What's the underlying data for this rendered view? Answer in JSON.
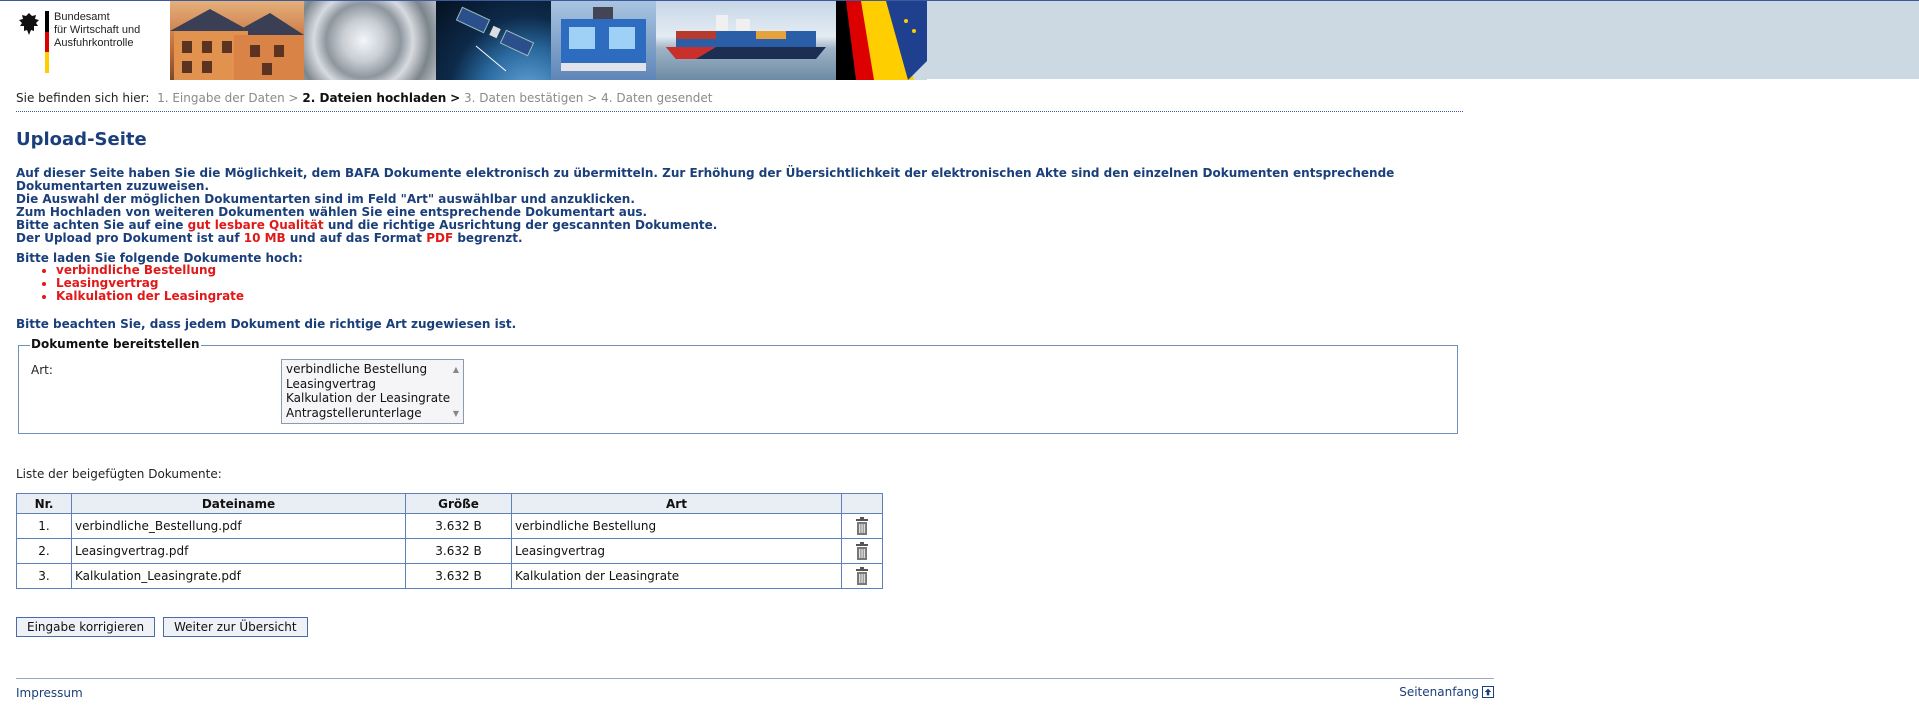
{
  "header": {
    "logo_lines": [
      "Bundesamt",
      "für Wirtschaft und",
      "Ausfuhrkontrolle"
    ],
    "flag_colors": [
      "#000000",
      "#dd0000",
      "#ffce00"
    ],
    "banner_images": [
      "houses-solar",
      "steel-coil",
      "satellite-earth",
      "industrial-machine",
      "container-ship",
      "flags-germany-eu"
    ]
  },
  "breadcrumb": {
    "prefix": "Sie befinden sich hier:",
    "step1": "1. Eingabe der Daten",
    "step2": "2. Dateien hochladen",
    "step3": "3. Daten bestätigen",
    "step4": "4. Daten gesendet",
    "sep": ">"
  },
  "page": {
    "title": "Upload-Seite",
    "intro_1": "Auf dieser Seite haben Sie die Möglichkeit, dem BAFA Dokumente elektronisch zu übermitteln. Zur Erhöhung der Übersichtlichkeit der elektronischen Akte sind den einzelnen Dokumenten entsprechende Dokumentarten zuzuweisen.",
    "intro_2": "Die Auswahl der möglichen Dokumentarten sind im Feld \"Art\" auswählbar und anzuklicken.",
    "intro_3": "Zum Hochladen von weiteren Dokumenten wählen Sie eine entsprechende Dokumentart aus.",
    "intro_4a": "Bitte achten Sie auf eine",
    "intro_4b": "gut lesbare Qualität",
    "intro_4c": "und die richtige Ausrichtung der gescannten Dokumente.",
    "intro_5a": "Der Upload pro Dokument ist auf",
    "intro_5b": "10 MB",
    "intro_5c": "und auf das Format",
    "intro_5d": "PDF",
    "intro_5e": "begrenzt.",
    "docs_heading": "Bitte laden Sie folgende Dokumente hoch:",
    "required_docs": [
      "verbindliche Bestellung",
      "Leasingvertrag",
      "Kalkulation der Leasingrate"
    ],
    "note": "Bitte beachten Sie, dass jedem Dokument die richtige Art zugewiesen ist.",
    "accent_color": "#1a3f7a",
    "highlight_color": "#e11919"
  },
  "upload": {
    "legend": "Dokumente bereitstellen",
    "art_label": "Art:",
    "art_options": [
      "verbindliche Bestellung",
      "Leasingvertrag",
      "Kalkulation der Leasingrate",
      "Antragstellerunterlage"
    ]
  },
  "list": {
    "label": "Liste der beigefügten Dokumente:",
    "columns": [
      "Nr.",
      "Dateiname",
      "Größe",
      "Art",
      ""
    ],
    "rows": [
      {
        "nr": "1.",
        "name": "verbindliche_Bestellung.pdf",
        "size": "3.632 B",
        "art": "verbindliche Bestellung"
      },
      {
        "nr": "2.",
        "name": "Leasingvertrag.pdf",
        "size": "3.632 B",
        "art": "Leasingvertrag"
      },
      {
        "nr": "3.",
        "name": "Kalkulation_Leasingrate.pdf",
        "size": "3.632 B",
        "art": "Kalkulation der Leasingrate"
      }
    ]
  },
  "buttons": {
    "correct": "Eingabe korrigieren",
    "next": "Weiter zur Übersicht"
  },
  "footer": {
    "impressum": "Impressum",
    "top": "Seitenanfang"
  }
}
